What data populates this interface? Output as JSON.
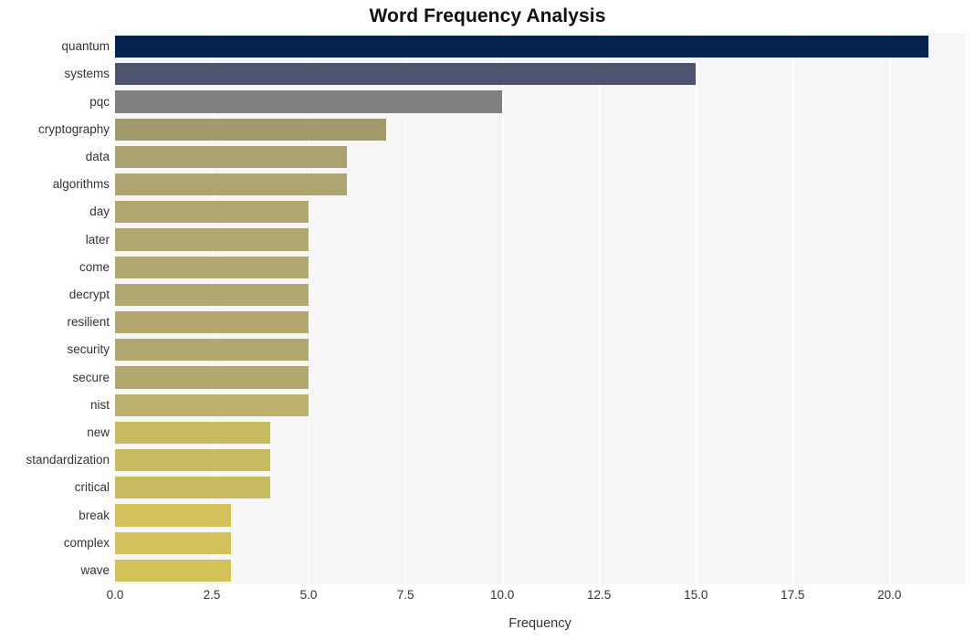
{
  "chart_data": {
    "type": "bar",
    "orientation": "horizontal",
    "title": "Word Frequency Analysis",
    "xlabel": "Frequency",
    "ylabel": "",
    "xlim": [
      0,
      21.95
    ],
    "xticks": [
      "0.0",
      "2.5",
      "5.0",
      "7.5",
      "10.0",
      "12.5",
      "15.0",
      "17.5",
      "20.0"
    ],
    "xtick_values": [
      0,
      2.5,
      5,
      7.5,
      10,
      12.5,
      15,
      17.5,
      20
    ],
    "grid": "vertical-white-on-light-gray",
    "legend": "none",
    "categories": [
      "quantum",
      "systems",
      "pqc",
      "cryptography",
      "data",
      "algorithms",
      "day",
      "later",
      "come",
      "decrypt",
      "resilient",
      "security",
      "secure",
      "nist",
      "new",
      "standardization",
      "critical",
      "break",
      "complex",
      "wave"
    ],
    "values": [
      21,
      15,
      10,
      7,
      6,
      6,
      5,
      5,
      5,
      5,
      5,
      5,
      5,
      5,
      4,
      4,
      4,
      3,
      3,
      3
    ],
    "bar_colors": [
      "#04234f",
      "#4d5470",
      "#82807e",
      "#a39a70",
      "#aba272",
      "#aea472",
      "#b2a86f",
      "#b2a86f",
      "#b2a86f",
      "#b2a86f",
      "#b2a86f",
      "#b2a86f",
      "#b2a86f",
      "#bdb06e",
      "#c9bb5f",
      "#c9bb5f",
      "#c9bb5f",
      "#d3c259",
      "#d3c259",
      "#d3c259"
    ],
    "plot_background": "#f6f6f7",
    "gridline_color": "#ffffff",
    "figure_background": "#ffffff",
    "text_color": "#333333",
    "title_color": "#111111"
  }
}
